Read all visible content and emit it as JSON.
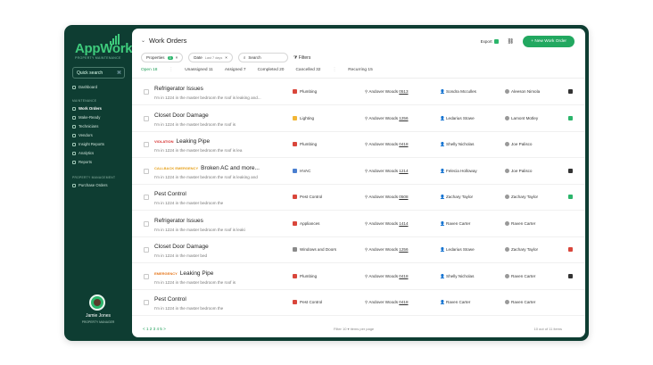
{
  "app": {
    "name": "AppWork",
    "tagline": "PROPERTY MAINTENANCE"
  },
  "sidebar": {
    "quick_search": "Quick search",
    "quick_search_key": "⌘",
    "dashboard": "Dashboard",
    "section_maintenance": "MAINTENANCE",
    "maintenance_items": [
      "Work Orders",
      "Make-Ready",
      "Technicians",
      "Vendors",
      "Insight Reports",
      "Analytics",
      "Reports"
    ],
    "section_property": "PROPERTY MANAGEMENT",
    "property_items": [
      "Purchase Orders"
    ],
    "user": {
      "name": "Jamie Jones",
      "role": "PROPERTY MANAGER"
    }
  },
  "header": {
    "title": "Work Orders",
    "export": "Export",
    "new_button": "+ New Work Order"
  },
  "filters": {
    "properties_label": "Properties",
    "properties_count": "3",
    "date_label": "Date",
    "date_value": "Last 7 days",
    "search_placeholder": "Search",
    "filters_label": "Filters"
  },
  "tabs": [
    {
      "label": "Open 18",
      "active": true
    },
    {
      "label": "Unassigned 11"
    },
    {
      "label": "Assigned 7"
    },
    {
      "label": "Completed 20"
    },
    {
      "label": "Cancelled 32"
    },
    {
      "label": "Recurring 15"
    }
  ],
  "rows": [
    {
      "tag": "",
      "tag_type": "",
      "title": "Refrigerator Issues",
      "desc": "I'm in 1224 in the master bedroom the roof is leaking and...",
      "category": "Plumbing",
      "cat_color": "#d9463b",
      "property": "Andover Woods",
      "unit": "0513",
      "person": "Sondra Mcculles",
      "assignee": "Aleeson Nimola",
      "lock_color": "#333"
    },
    {
      "tag": "",
      "tag_type": "",
      "title": "Closet Door Damage",
      "desc": "I'm in 1224 in the master bedroom the roof is",
      "category": "Lighting",
      "cat_color": "#f2b636",
      "property": "Andover Woods",
      "unit": "1256",
      "person": "Ledarius Stowe",
      "assignee": "Lamont Motley",
      "lock_color": "#2bb56b"
    },
    {
      "tag": "VIOLATION",
      "tag_type": "v",
      "title": "Leaking Pipe",
      "desc": "I'm in 1224 in the master bedroom the roof is lea",
      "category": "Plumbing",
      "cat_color": "#d9463b",
      "property": "Andover Woods",
      "unit": "0418",
      "person": "Shelly Nicholas",
      "assignee": "Joe Palisco",
      "lock_color": ""
    },
    {
      "tag": "CALLBACK  EMERGENCY",
      "tag_type": "c",
      "title": "Broken AC and more...",
      "desc": "I'm in 1224 in the master bedroom the roof is leaking and",
      "category": "HVAC",
      "cat_color": "#4a7fd0",
      "property": "Andover Woods",
      "unit": "1214",
      "person": "Felecia Holloway",
      "assignee": "Joe Palisco",
      "lock_color": "#333"
    },
    {
      "tag": "",
      "tag_type": "",
      "title": "Pest Control",
      "desc": "I'm in 1224 in the master bedroom the",
      "category": "Pest Control",
      "cat_color": "#d9463b",
      "property": "Andover Woods",
      "unit": "0508",
      "person": "Zachary Taylor",
      "assignee": "Zachary Taylor",
      "lock_color": "#2bb56b"
    },
    {
      "tag": "",
      "tag_type": "",
      "title": "Refrigerator Issues",
      "desc": "I'm in 1224 in the master bedroom the roof is leaki",
      "category": "Appliances",
      "cat_color": "#d9463b",
      "property": "Andover Woods",
      "unit": "1414",
      "person": "Raven Carter",
      "assignee": "Raven Carter",
      "lock_color": ""
    },
    {
      "tag": "",
      "tag_type": "",
      "title": "Closet Door Damage",
      "desc": "I'm in 1224 in the master bed",
      "category": "Windows and Doors",
      "cat_color": "#8a8a8a",
      "property": "Andover Woods",
      "unit": "1256",
      "person": "Ledarius Stowe",
      "assignee": "Zachary Taylor",
      "lock_color": "#d9463b"
    },
    {
      "tag": "EMERGENCY",
      "tag_type": "e",
      "title": "Leaking Pipe",
      "desc": "I'm in 1224 in the master bedroom the roof is",
      "category": "Plumbing",
      "cat_color": "#d9463b",
      "property": "Andover Woods",
      "unit": "0418",
      "person": "Shelly Nicholas",
      "assignee": "Raven Carter",
      "lock_color": "#333"
    },
    {
      "tag": "",
      "tag_type": "",
      "title": "Pest Control",
      "desc": "I'm in 1224 in the master bedroom the",
      "category": "Pest Control",
      "cat_color": "#d9463b",
      "property": "Andover Woods",
      "unit": "0418",
      "person": "Raven Carter",
      "assignee": "Raven Carter",
      "lock_color": ""
    }
  ],
  "footer": {
    "pages": "< 1 2 3 4 5 >",
    "per_page": "Filter 10 ▾ items per page",
    "count": "10 out of 11 items"
  }
}
